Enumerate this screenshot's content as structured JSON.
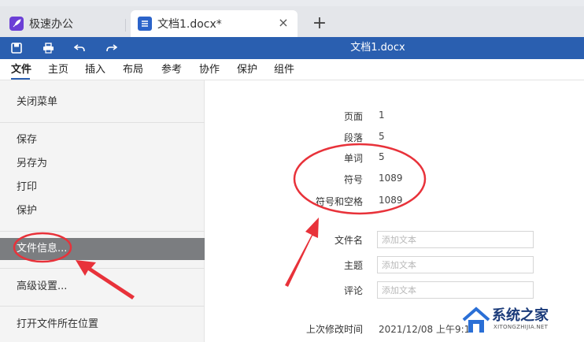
{
  "tabs": {
    "home_label": "极速办公",
    "doc_label": "文档1.docx*",
    "close_symbol": "×",
    "new_tab_symbol": "+"
  },
  "toolbar": {
    "doc_title": "文档1.docx",
    "icons": [
      "save-icon",
      "print-icon",
      "undo-icon",
      "redo-icon"
    ]
  },
  "menu": {
    "items": [
      "文件",
      "主页",
      "插入",
      "布局",
      "参考",
      "协作",
      "保护",
      "组件"
    ]
  },
  "left_panel": {
    "close_menu": "关闭菜单",
    "save": "保存",
    "save_as": "另存为",
    "print": "打印",
    "protect": "保护",
    "file_info": "文件信息...",
    "advanced": "高级设置...",
    "open_location": "打开文件所在位置"
  },
  "stats": [
    {
      "label": "页面",
      "value": "1"
    },
    {
      "label": "段落",
      "value": "5"
    },
    {
      "label": "单词",
      "value": "5"
    },
    {
      "label": "符号",
      "value": "1089"
    },
    {
      "label": "符号和空格",
      "value": "1089"
    }
  ],
  "fields": [
    {
      "label": "文件名",
      "placeholder": "添加文本"
    },
    {
      "label": "主题",
      "placeholder": "添加文本"
    },
    {
      "label": "评论",
      "placeholder": "添加文本"
    }
  ],
  "last_modified": {
    "label": "上次修改时间",
    "value": "2021/12/08 上午9:15"
  },
  "watermark": {
    "title": "系统之家",
    "subtitle": "XITONGZHIJIA.NET"
  },
  "colors": {
    "toolbar_blue": "#2a5fb0",
    "annotation_red": "#e8323a",
    "selected_item": "#7b7d80"
  }
}
